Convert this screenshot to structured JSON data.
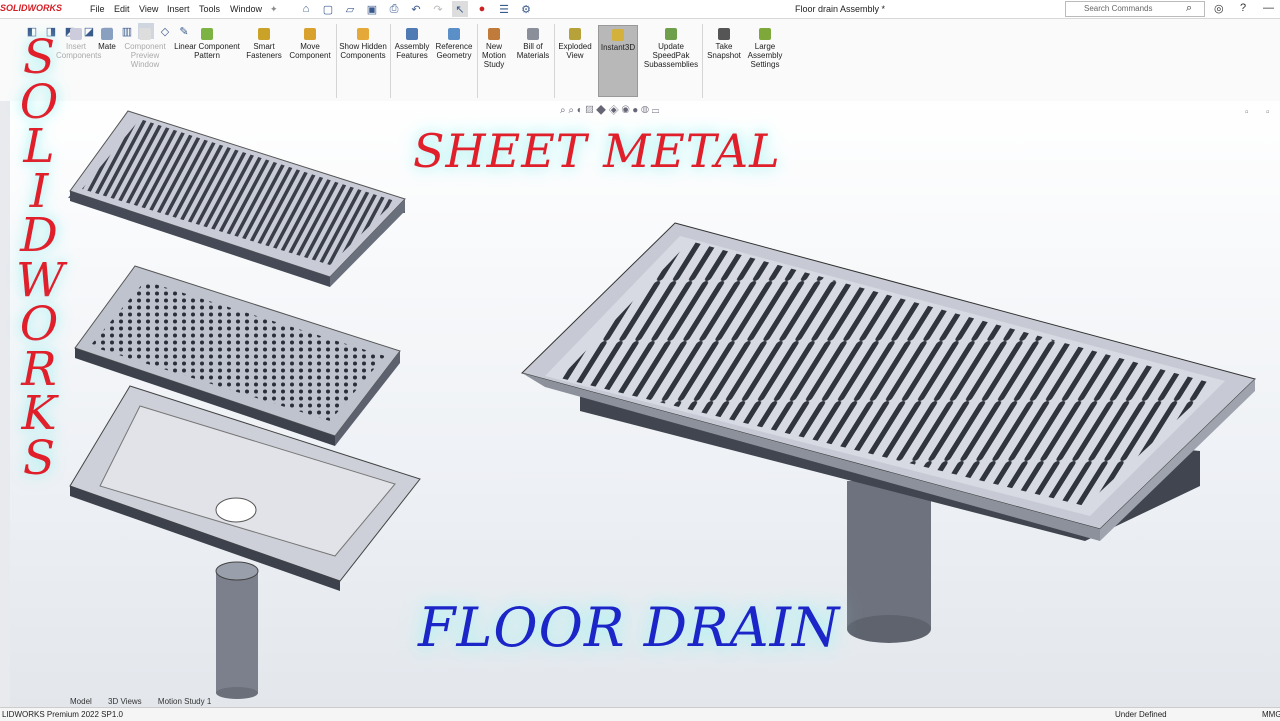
{
  "app": {
    "logo": "SOLIDWORKS",
    "document_title": "Floor drain Assembly *"
  },
  "menu": {
    "items": [
      "File",
      "Edit",
      "View",
      "Insert",
      "Tools",
      "Window"
    ]
  },
  "search": {
    "placeholder": "Search Commands"
  },
  "commands": [
    {
      "id": "insert-components",
      "label": "Insert Components",
      "state": "disabled"
    },
    {
      "id": "mate",
      "label": "Mate",
      "state": "normal"
    },
    {
      "id": "component-preview",
      "label": "Component Preview Window",
      "state": "disabled"
    },
    {
      "id": "linear-pattern",
      "label": "Linear Component Pattern",
      "state": "normal"
    },
    {
      "id": "smart-fasteners",
      "label": "Smart Fasteners",
      "state": "normal"
    },
    {
      "id": "move-component",
      "label": "Move Component",
      "state": "normal"
    },
    {
      "id": "show-hidden",
      "label": "Show Hidden Components",
      "state": "normal"
    },
    {
      "id": "assembly-features",
      "label": "Assembly Features",
      "state": "normal"
    },
    {
      "id": "reference-geometry",
      "label": "Reference Geometry",
      "state": "normal"
    },
    {
      "id": "new-motion-study",
      "label": "New Motion Study",
      "state": "normal"
    },
    {
      "id": "bill-of-materials",
      "label": "Bill of Materials",
      "state": "normal"
    },
    {
      "id": "exploded-view",
      "label": "Exploded View",
      "state": "normal"
    },
    {
      "id": "instant3d",
      "label": "Instant3D",
      "state": "active"
    },
    {
      "id": "update-speedpak",
      "label": "Update SpeedPak Subassemblies",
      "state": "normal"
    },
    {
      "id": "take-snapshot",
      "label": "Take Snapshot",
      "state": "normal"
    },
    {
      "id": "large-assembly",
      "label": "Large Assembly Settings",
      "state": "normal"
    }
  ],
  "overlay": {
    "sheet_metal": "SHEET METAL",
    "floor_drain": "FLOOR DRAIN",
    "vertical_letters": [
      "S",
      "O",
      "L",
      "I",
      "D",
      "W",
      "O",
      "R",
      "K",
      "S"
    ]
  },
  "bottom_tabs": [
    "Model",
    "3D Views",
    "Motion Study 1"
  ],
  "status": {
    "left": "LIDWORKS Premium 2022 SP1.0",
    "right": "Under Defined",
    "units": "MMG"
  },
  "colors": {
    "red_text": "#e01f2a",
    "blue_text": "#1b25c8",
    "glow": "#aef3f3",
    "brand_red": "#d31f26"
  }
}
